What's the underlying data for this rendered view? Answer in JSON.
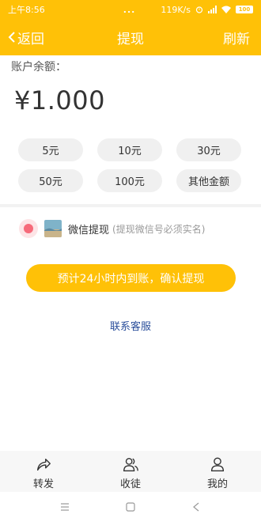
{
  "status_bar": {
    "time": "上午8:56",
    "dots": "...",
    "network_speed": "119K/s",
    "battery": "100"
  },
  "header": {
    "back_label": "返回",
    "title": "提现",
    "refresh_label": "刷新"
  },
  "balance": {
    "label": "账户余额：",
    "value": "¥1.000"
  },
  "amount_options": [
    "5元",
    "10元",
    "30元",
    "50元",
    "100元",
    "其他金额"
  ],
  "withdraw_method": {
    "label": "微信提现",
    "note": "(提现微信号必须实名)",
    "selected": true
  },
  "confirm_button": "预计24小时内到账，确认提现",
  "service_link": "联系客服",
  "tabbar": {
    "items": [
      {
        "label": "转发",
        "icon": "share-icon"
      },
      {
        "label": "收徒",
        "icon": "users-icon"
      },
      {
        "label": "我的",
        "icon": "user-icon"
      }
    ]
  },
  "nav_bar": {
    "icons": [
      "menu-icon",
      "home-icon",
      "back-icon"
    ]
  },
  "colors": {
    "accent": "#ffc107",
    "radio": "#f66a7a",
    "link": "#2a4e9b"
  }
}
